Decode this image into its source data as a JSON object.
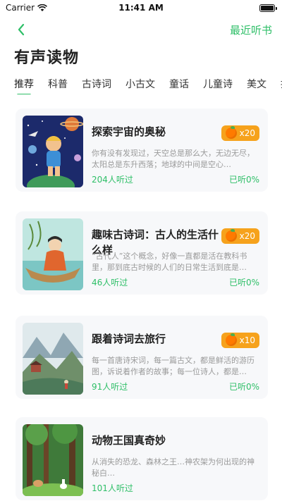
{
  "status_bar": {
    "carrier": "Carrier",
    "time": "11:41 AM"
  },
  "nav": {
    "recent_label": "最近听书"
  },
  "page_title": "有声读物",
  "tabs": [
    {
      "label": "推荐",
      "active": true
    },
    {
      "label": "科普"
    },
    {
      "label": "古诗词"
    },
    {
      "label": "小古文"
    },
    {
      "label": "童话"
    },
    {
      "label": "儿童诗"
    },
    {
      "label": "美文"
    },
    {
      "label": "拼"
    }
  ],
  "books": [
    {
      "title": "探索宇宙的奥秘",
      "desc": "你有没有发现过，天空总是那么大，无边无尽，太阳总是东升西落；地球的中间是空心…",
      "listeners": "204人听过",
      "progress": "已听0%",
      "reward": "x20"
    },
    {
      "title": "趣味古诗词：古人的生活什么样",
      "desc": "“古代人”这个概念，好像一直都是活在教科书里，那到底古时候的人们的日常生活到底是…",
      "listeners": "46人听过",
      "progress": "已听0%",
      "reward": "x20"
    },
    {
      "title": "跟着诗词去旅行",
      "desc": "每一首唐诗宋词，每一篇古文，都是鲜活的游历图，诉说着作者的故事；每一位诗人，都是…",
      "listeners": "91人听过",
      "progress": "已听0%",
      "reward": "x10"
    },
    {
      "title": "动物王国真奇妙",
      "desc": "从消失的恐龙、森林之王…神农架为何出现的神秘白…",
      "listeners": "101人听过",
      "progress": "",
      "reward": ""
    }
  ],
  "colors": {
    "accent": "#2fbf68",
    "reward": "#f6a21c"
  }
}
